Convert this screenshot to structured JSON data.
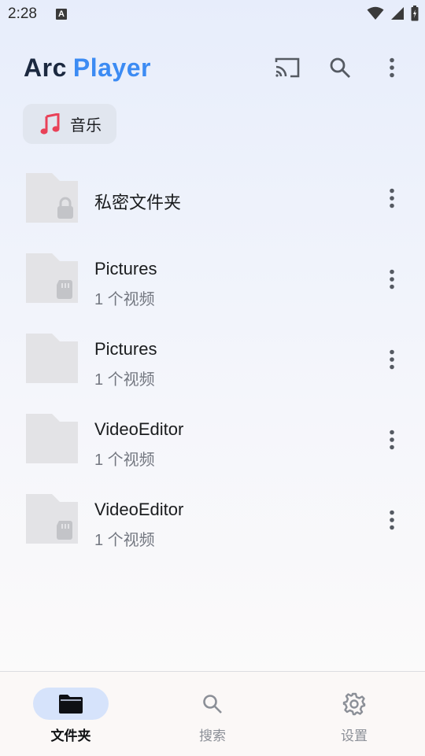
{
  "status_bar": {
    "time": "2:28",
    "notification_badge": "A"
  },
  "header": {
    "logo_left": "Arc",
    "logo_right": "Player",
    "logo_left_color": "#1c2940",
    "logo_right_color": "#3c8bf3",
    "actions": [
      {
        "icon": "cast-icon"
      },
      {
        "icon": "search-icon"
      },
      {
        "icon": "more-vert-icon"
      }
    ]
  },
  "chip": {
    "label": "音乐",
    "icon": "music-note-icon",
    "icon_color": "#e94158"
  },
  "folders": [
    {
      "title": "私密文件夹",
      "subtitle": "",
      "badge": "lock"
    },
    {
      "title": "Pictures",
      "subtitle": "1 个视频",
      "badge": "sd-card"
    },
    {
      "title": "Pictures",
      "subtitle": "1 个视频",
      "badge": ""
    },
    {
      "title": "VideoEditor",
      "subtitle": "1 个视频",
      "badge": ""
    },
    {
      "title": "VideoEditor",
      "subtitle": "1 个视频",
      "badge": "sd-card"
    }
  ],
  "bottom_nav": [
    {
      "label": "文件夹",
      "icon": "folder-icon",
      "active": true
    },
    {
      "label": "搜索",
      "icon": "search-icon",
      "active": false
    },
    {
      "label": "设置",
      "icon": "settings-icon",
      "active": false
    }
  ],
  "colors": {
    "accent": "#3c8bf3",
    "active_pill": "#d6e3fb",
    "folder_gray": "#e3e3e6"
  }
}
